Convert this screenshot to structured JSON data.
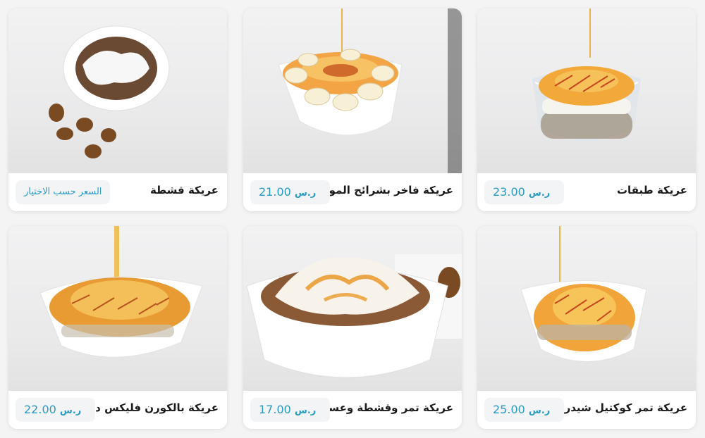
{
  "currency_symbol": "ر.س",
  "products": [
    {
      "name": "عريكة طبقات",
      "price": "23.00",
      "has_currency": true
    },
    {
      "name": "عريكة فاخر بشرائح الموز",
      "price": "21.00",
      "has_currency": true
    },
    {
      "name": "عريكة قشطة",
      "price": "السعر حسب الاختيار",
      "has_currency": false
    },
    {
      "name": "عريكة تمر كوكتيل شيدر",
      "price": "25.00",
      "has_currency": true
    },
    {
      "name": "عريكة تمر وقشطة وعسل",
      "price": "17.00",
      "has_currency": true
    },
    {
      "name": "عريكة بالكورن فليكس ديلوكس",
      "price": "22.00",
      "has_currency": true
    }
  ]
}
